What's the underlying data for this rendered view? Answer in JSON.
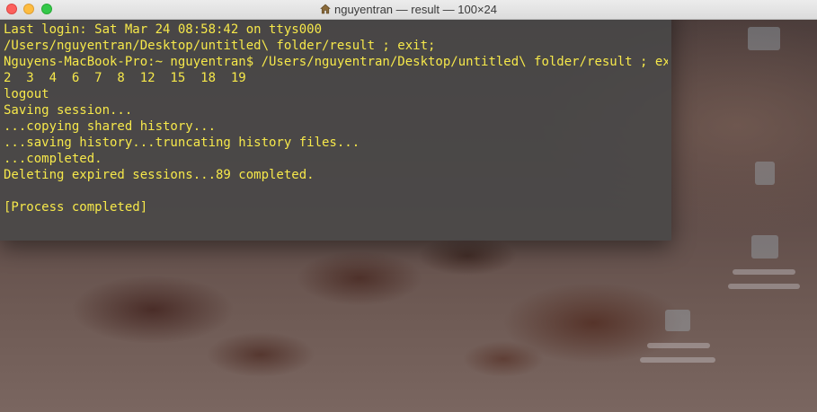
{
  "window": {
    "title": "nguyentran — result — 100×24",
    "title_icon": "home-icon"
  },
  "terminal": {
    "text_color": "#f6e84a",
    "lines": [
      "Last login: Sat Mar 24 08:58:42 on ttys000",
      "/Users/nguyentran/Desktop/untitled\\ folder/result ; exit;",
      "Nguyens-MacBook-Pro:~ nguyentran$ /Users/nguyentran/Desktop/untitled\\ folder/result ; exit;",
      "2  3  4  6  7  8  12  15  18  19",
      "logout",
      "Saving session...",
      "...copying shared history...",
      "...saving history...truncating history files...",
      "...completed.",
      "Deleting expired sessions...89 completed.",
      "",
      "[Process completed]"
    ]
  }
}
